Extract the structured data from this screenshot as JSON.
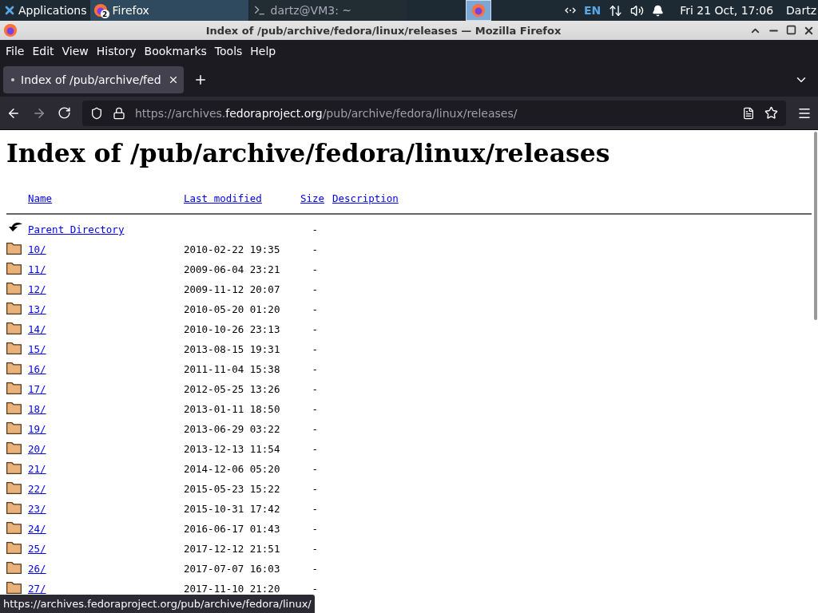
{
  "taskbar": {
    "menu": "Applications",
    "tasks": [
      {
        "kind": "browser",
        "label": "Firefox",
        "badge": "2",
        "selected": true
      },
      {
        "kind": "terminal",
        "label": "dartz@VM3: ~",
        "selected": false
      }
    ],
    "launcher": {
      "selected": true
    },
    "tray": {
      "keyboard": "EN",
      "clock": "Fri 21 Oct, 17:06",
      "user": "Dartz"
    }
  },
  "window": {
    "title": "Index of /pub/archive/fedora/linux/releases — Mozilla Firefox"
  },
  "menu": [
    "File",
    "Edit",
    "View",
    "History",
    "Bookmarks",
    "Tools",
    "Help"
  ],
  "tabs": [
    {
      "label": "Index of /pub/archive/fed",
      "selected": true
    }
  ],
  "address": {
    "prefix": "https://archives.",
    "domain": "fedoraproject.org",
    "path": "/pub/archive/fedora/linux/releases/"
  },
  "page": {
    "heading": "Index of /pub/archive/fedora/linux/releases",
    "columns": [
      "Name",
      "Last modified",
      "Size",
      "Description"
    ],
    "rows": [
      {
        "kind": "parent",
        "name": "Parent Directory",
        "modified": "",
        "size": "-"
      },
      {
        "kind": "folder",
        "name": "10/",
        "modified": "2010-02-22 19:35",
        "size": "-"
      },
      {
        "kind": "folder",
        "name": "11/",
        "modified": "2009-06-04 23:21",
        "size": "-"
      },
      {
        "kind": "folder",
        "name": "12/",
        "modified": "2009-11-12 20:07",
        "size": "-"
      },
      {
        "kind": "folder",
        "name": "13/",
        "modified": "2010-05-20 01:20",
        "size": "-"
      },
      {
        "kind": "folder",
        "name": "14/",
        "modified": "2010-10-26 23:13",
        "size": "-"
      },
      {
        "kind": "folder",
        "name": "15/",
        "modified": "2013-08-15 19:31",
        "size": "-"
      },
      {
        "kind": "folder",
        "name": "16/",
        "modified": "2011-11-04 15:38",
        "size": "-"
      },
      {
        "kind": "folder",
        "name": "17/",
        "modified": "2012-05-25 13:26",
        "size": "-"
      },
      {
        "kind": "folder",
        "name": "18/",
        "modified": "2013-01-11 18:50",
        "size": "-"
      },
      {
        "kind": "folder",
        "name": "19/",
        "modified": "2013-06-29 03:22",
        "size": "-"
      },
      {
        "kind": "folder",
        "name": "20/",
        "modified": "2013-12-13 11:54",
        "size": "-"
      },
      {
        "kind": "folder",
        "name": "21/",
        "modified": "2014-12-06 05:20",
        "size": "-"
      },
      {
        "kind": "folder",
        "name": "22/",
        "modified": "2015-05-23 15:22",
        "size": "-"
      },
      {
        "kind": "folder",
        "name": "23/",
        "modified": "2015-10-31 17:42",
        "size": "-"
      },
      {
        "kind": "folder",
        "name": "24/",
        "modified": "2016-06-17 01:43",
        "size": "-"
      },
      {
        "kind": "folder",
        "name": "25/",
        "modified": "2017-12-12 21:51",
        "size": "-"
      },
      {
        "kind": "folder",
        "name": "26/",
        "modified": "2017-07-07 16:03",
        "size": "-"
      },
      {
        "kind": "folder",
        "name": "27/",
        "modified": "2017-11-10 21:20",
        "size": "-"
      }
    ]
  },
  "status_link": "https://archives.fedoraproject.org/pub/archive/fedora/linux/"
}
